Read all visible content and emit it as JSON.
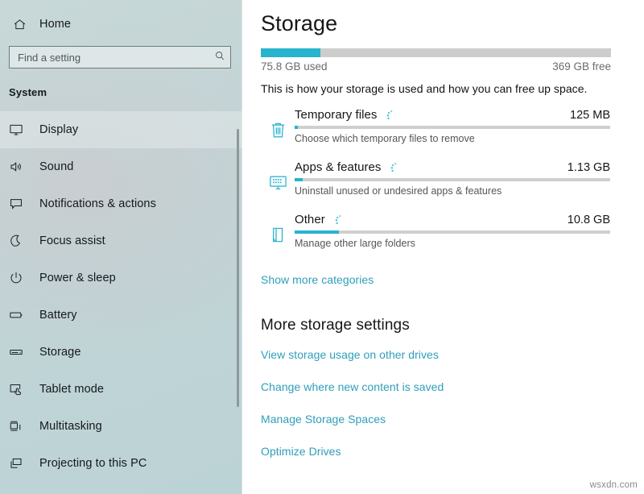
{
  "sidebar": {
    "home_label": "Home",
    "home_icon": "home-icon",
    "search": {
      "placeholder": "Find a setting",
      "value": "",
      "icon": "search-icon"
    },
    "section_heading": "System",
    "items": [
      {
        "label": "Display",
        "icon": "monitor-icon",
        "selected": true
      },
      {
        "label": "Sound",
        "icon": "speaker-icon",
        "selected": false
      },
      {
        "label": "Notifications & actions",
        "icon": "notification-icon",
        "selected": false
      },
      {
        "label": "Focus assist",
        "icon": "moon-icon",
        "selected": false
      },
      {
        "label": "Power & sleep",
        "icon": "power-icon",
        "selected": false
      },
      {
        "label": "Battery",
        "icon": "battery-icon",
        "selected": false
      },
      {
        "label": "Storage",
        "icon": "drive-icon",
        "selected": false
      },
      {
        "label": "Tablet mode",
        "icon": "tablet-touch-icon",
        "selected": false
      },
      {
        "label": "Multitasking",
        "icon": "multitask-icon",
        "selected": false
      },
      {
        "label": "Projecting to this PC",
        "icon": "project-icon",
        "selected": false
      }
    ]
  },
  "main": {
    "title": "Storage",
    "drive": {
      "used_label": "75.8 GB used",
      "free_label": "369 GB free",
      "used_percent": 17
    },
    "intro": "This is how your storage is used and how you can free up space.",
    "categories": [
      {
        "name": "Temporary files",
        "size": "125 MB",
        "description": "Choose which temporary files to remove",
        "percent": 1,
        "icon": "trash-icon",
        "spinner": "loading-spinner-icon"
      },
      {
        "name": "Apps & features",
        "size": "1.13 GB",
        "description": "Uninstall unused or undesired apps & features",
        "percent": 2.5,
        "icon": "apps-monitor-icon",
        "spinner": "loading-spinner-icon"
      },
      {
        "name": "Other",
        "size": "10.8 GB",
        "description": "Manage other large folders",
        "percent": 14,
        "icon": "folder-page-icon",
        "spinner": "loading-spinner-icon"
      }
    ],
    "show_more_label": "Show more categories",
    "more_heading": "More storage settings",
    "more_links": [
      "View storage usage on other drives",
      "Change where new content is saved",
      "Manage Storage Spaces",
      "Optimize Drives"
    ]
  },
  "watermark": "wsxdn.com",
  "colors": {
    "accent": "#27b4ce",
    "link": "#2f9ebb",
    "sidebar_bg": "#c3d5d6",
    "track": "#cdcdcd"
  }
}
